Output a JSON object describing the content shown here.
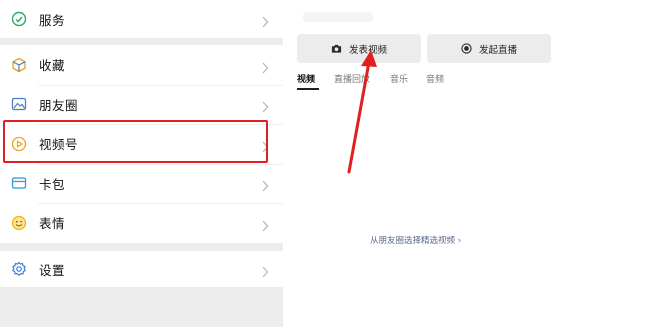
{
  "menu": {
    "services": {
      "label": "服务",
      "icon": "services-check-icon"
    },
    "items": [
      {
        "label": "收藏",
        "icon": "favorites-cube-icon"
      },
      {
        "label": "朋友圈",
        "icon": "moments-photo-icon"
      },
      {
        "label": "视频号",
        "icon": "channels-play-icon"
      },
      {
        "label": "卡包",
        "icon": "card-wallet-icon"
      },
      {
        "label": "表情",
        "icon": "sticker-smile-icon"
      }
    ],
    "settings": {
      "label": "设置",
      "icon": "settings-gear-icon"
    }
  },
  "channels": {
    "publish_button": "发表视频",
    "live_button": "发起直播",
    "tabs": [
      "视频",
      "直播回放",
      "音乐",
      "音频"
    ],
    "active_tab": "视频",
    "select_from_moments": "从朋友圈选择精选视频 ›"
  },
  "colors": {
    "highlight": "#e02020",
    "services_green": "#2aae67",
    "favorites_orange": "#f59a23",
    "moments_blue": "#4a7ec5",
    "channels_orange": "#f0a020",
    "card_teal": "#2b9ad6",
    "sticker_yellow": "#f2b705",
    "settings_blue": "#3b7dd8"
  }
}
